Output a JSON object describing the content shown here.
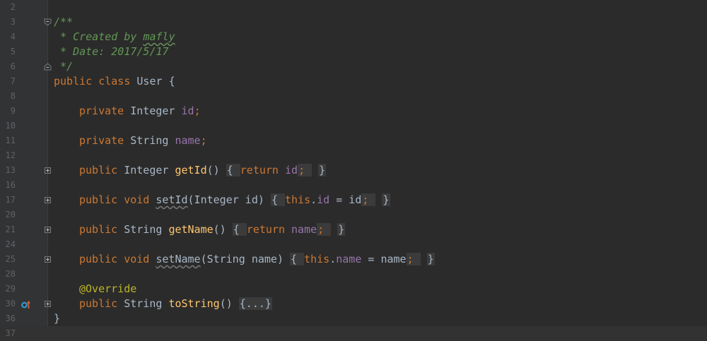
{
  "editor": {
    "line_numbers": [
      "2",
      "3",
      "4",
      "5",
      "6",
      "7",
      "8",
      "9",
      "10",
      "11",
      "12",
      "13",
      "16",
      "17",
      "20",
      "21",
      "24",
      "25",
      "28",
      "29",
      "30",
      "36",
      "37"
    ],
    "comment": {
      "open": "/**",
      "author_prefix": " * Created by ",
      "author_name": "mafly",
      "date": " * Date: 2017/5/17",
      "close": " */"
    },
    "class_decl": {
      "kw_public": "public",
      "kw_class": "class",
      "name": "User",
      "brace": "{"
    },
    "field_id": {
      "kw": "private",
      "type": "Integer",
      "name": "id",
      "end": ";"
    },
    "field_name": {
      "kw": "private",
      "type": "String",
      "name": "name",
      "end": ";"
    },
    "method_getId": {
      "kw": "public",
      "type": "Integer",
      "name": "getId",
      "params": "()",
      "open": "{",
      "ret_kw": "return",
      "ret_val": "id",
      "semi": ";",
      "close": "}"
    },
    "method_setId": {
      "kw1": "public",
      "kw2": "void",
      "name": "setId",
      "params": "(Integer id)",
      "open": "{",
      "this_kw": "this",
      "dot": ".",
      "field": "id",
      "assign": " = id",
      "semi": ";",
      "close": "}"
    },
    "method_getName": {
      "kw": "public",
      "type": "String",
      "name": "getName",
      "params": "()",
      "open": "{",
      "ret_kw": "return",
      "ret_val": "name",
      "semi": ";",
      "close": "}"
    },
    "method_setName": {
      "kw1": "public",
      "kw2": "void",
      "name": "setName",
      "params": "(String name)",
      "open": "{",
      "this_kw": "this",
      "dot": ".",
      "field": "name",
      "assign": " = name",
      "semi": ";",
      "close": "}"
    },
    "annotation": "@Override",
    "method_toString": {
      "kw": "public",
      "type": "String",
      "name": "toString",
      "params": "()",
      "collapsed": "{...}"
    },
    "class_close": "}"
  },
  "colors": {
    "background": "#2b2b2b",
    "gutter": "#313335",
    "keyword": "#cc7832",
    "field": "#9876aa",
    "method": "#ffc66d",
    "comment": "#629755",
    "annotation": "#bbb529",
    "text": "#a9b7c6",
    "line_number": "#606366"
  }
}
